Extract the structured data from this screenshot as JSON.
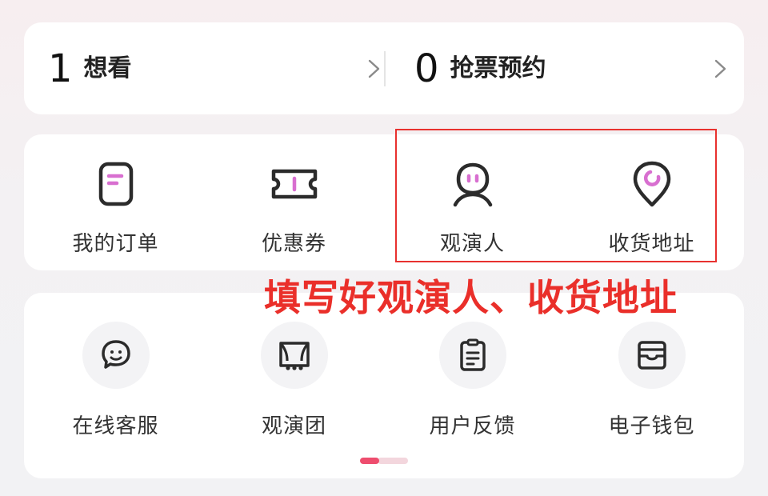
{
  "stats": {
    "wishlist": {
      "count": "1",
      "label": "想看"
    },
    "reservation": {
      "count": "0",
      "label": "抢票预约"
    }
  },
  "quick_actions": [
    {
      "label": "我的订单",
      "icon": "order-icon"
    },
    {
      "label": "优惠券",
      "icon": "coupon-icon"
    },
    {
      "label": "观演人",
      "icon": "audience-icon"
    },
    {
      "label": "收货地址",
      "icon": "location-icon"
    }
  ],
  "services": [
    {
      "label": "在线客服",
      "icon": "customer-service-icon"
    },
    {
      "label": "观演团",
      "icon": "theater-group-icon"
    },
    {
      "label": "用户反馈",
      "icon": "feedback-icon"
    },
    {
      "label": "电子钱包",
      "icon": "wallet-icon"
    }
  ],
  "annotation": {
    "text": "填写好观演人、收货地址"
  },
  "colors": {
    "accent": "#ee4d6e",
    "annotation": "#ea2f2a",
    "icon_dark": "#2b2b2b"
  }
}
